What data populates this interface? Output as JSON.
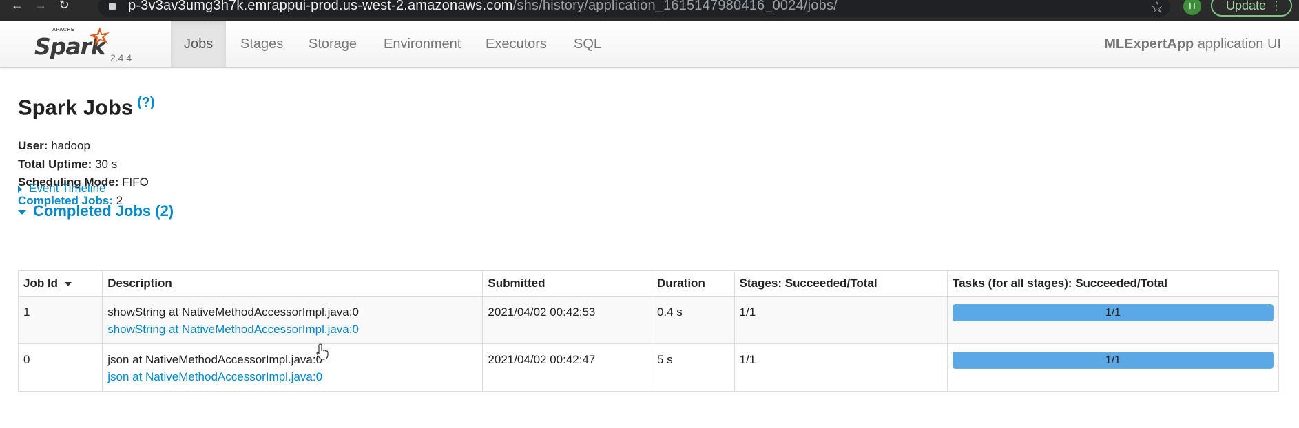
{
  "browser": {
    "url_host": "p-3v3av3umg3h7k.emrappui-prod.us-west-2.amazonaws.com",
    "url_path": "/shs/history/application_1615147980416_0024/jobs/",
    "avatar_letter": "H",
    "update_label": "Update"
  },
  "navbar": {
    "brand_small": "APACHE",
    "brand_name": "Spark",
    "version": "2.4.4",
    "tabs": [
      {
        "label": "Jobs",
        "active": true
      },
      {
        "label": "Stages",
        "active": false
      },
      {
        "label": "Storage",
        "active": false
      },
      {
        "label": "Environment",
        "active": false
      },
      {
        "label": "Executors",
        "active": false
      },
      {
        "label": "SQL",
        "active": false
      }
    ],
    "app_name": "MLExpertApp",
    "app_suffix": " application UI"
  },
  "page": {
    "title": "Spark Jobs",
    "help": "(?)",
    "summary": {
      "user_label": "User:",
      "user_value": " hadoop",
      "uptime_label": "Total Uptime:",
      "uptime_value": " 30 s",
      "sched_label": "Scheduling Mode:",
      "sched_value": " FIFO",
      "completed_label": "Completed Jobs:",
      "completed_value": " 2"
    },
    "event_timeline": "Event Timeline",
    "completed_section": "Completed Jobs (2)"
  },
  "table": {
    "headers": {
      "job_id": "Job Id",
      "description": "Description",
      "submitted": "Submitted",
      "duration": "Duration",
      "stages": "Stages: Succeeded/Total",
      "tasks": "Tasks (for all stages): Succeeded/Total"
    },
    "rows": [
      {
        "job_id": "1",
        "desc_main": "showString at NativeMethodAccessorImpl.java:0",
        "desc_link": "showString at NativeMethodAccessorImpl.java:0",
        "submitted": "2021/04/02 00:42:53",
        "duration": "0.4 s",
        "stages": "1/1",
        "tasks": "1/1",
        "tasks_fraction": 1.0
      },
      {
        "job_id": "0",
        "desc_main": "json at NativeMethodAccessorImpl.java:0",
        "desc_link": "json at NativeMethodAccessorImpl.java:0",
        "submitted": "2021/04/02 00:42:47",
        "duration": "5 s",
        "stages": "1/1",
        "tasks": "1/1",
        "tasks_fraction": 1.0
      }
    ]
  },
  "colors": {
    "link": "#0088cc",
    "progress": "#5aa9e6"
  },
  "icons": {
    "back": "arrow-left-icon",
    "forward": "arrow-right-icon",
    "reload": "reload-icon",
    "bookmark": "star-icon",
    "cursor": "hand-pointer-icon"
  }
}
